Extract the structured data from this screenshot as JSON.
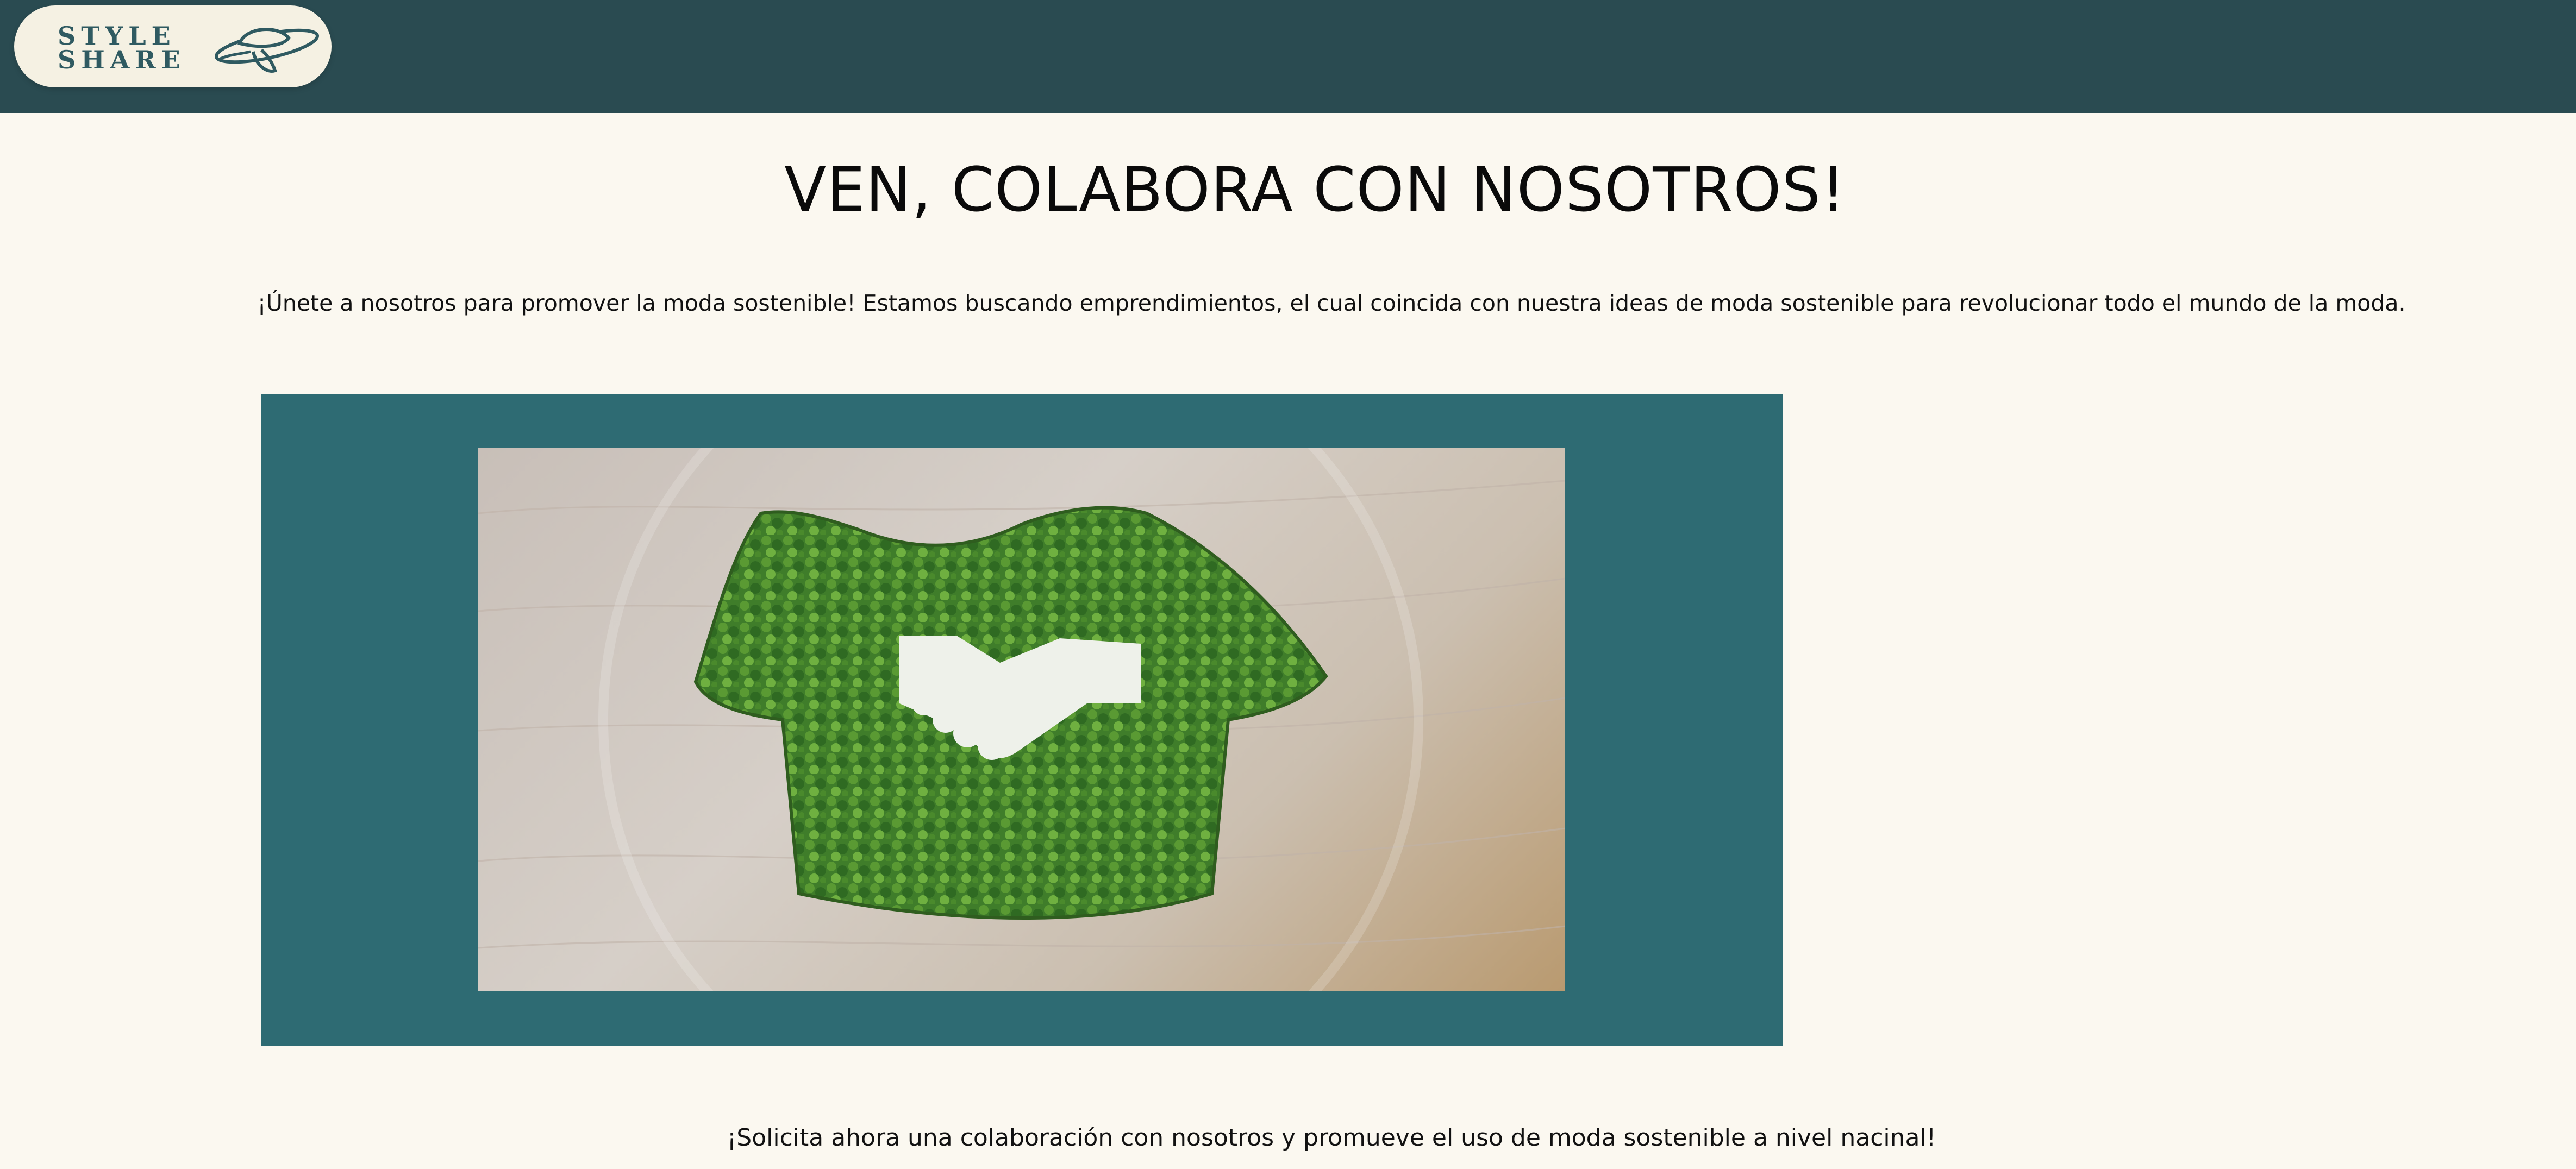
{
  "header": {
    "logo": {
      "line1": "STYLE",
      "line2": "SHARE",
      "icon": "hat-icon"
    }
  },
  "main": {
    "title": "VEN, COLABORA CON NOSOTROS!",
    "intro": "¡Únete a nosotros para promover la moda sostenible! Estamos buscando emprendimientos, el cual coincida con nuestra ideas de moda sostenible para revolucionar todo el mundo de la moda.",
    "banner_image": "green-leaf-tshirt-handshake-image",
    "closing": "¡Solicita ahora una colaboración con nosotros y promueve el uso de moda sostenible a nivel nacinal!"
  },
  "colors": {
    "header_bg": "#2a4b51",
    "page_bg": "#fbf8f0",
    "banner_bg": "#2e6b73",
    "logo_text": "#2f5a61"
  }
}
